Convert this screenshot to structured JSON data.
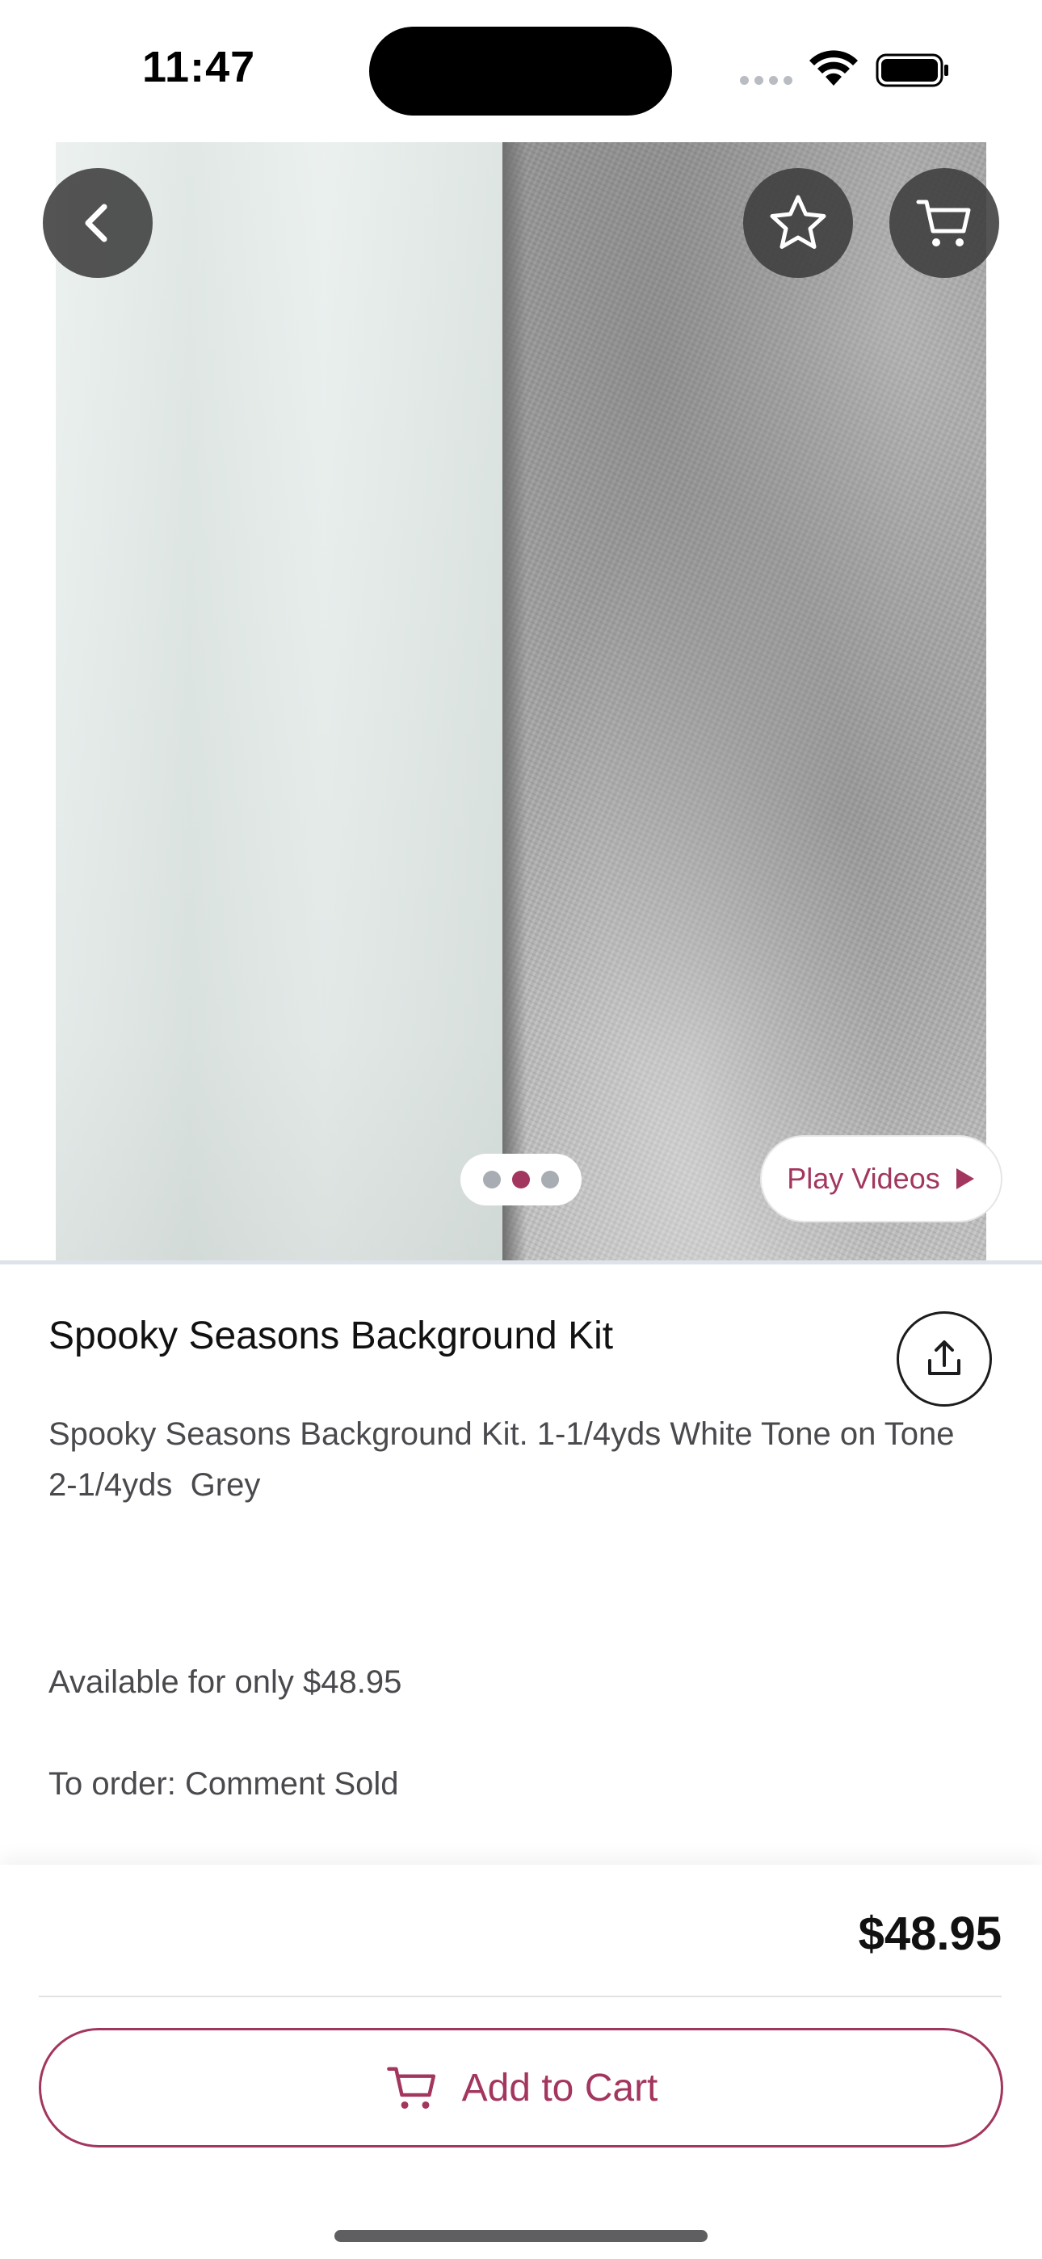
{
  "status_bar": {
    "time": "11:47",
    "icons": [
      "cellular-signal-icon",
      "wifi-icon",
      "battery-icon"
    ]
  },
  "hero": {
    "image_description_icons": [
      "fabric-white-tone",
      "fabric-grey"
    ],
    "buttons": [
      "back-icon",
      "star-icon",
      "cart-icon"
    ],
    "pager": {
      "count": 3,
      "active_index": 1
    },
    "play_videos_label": "Play Videos"
  },
  "product": {
    "title": "Spooky Seasons Background Kit",
    "description_line1": "Spooky Seasons Background Kit. 1-1/4yds White Tone on Tone",
    "description_line2": "2-1/4yds  Grey",
    "availability": "Available for only $48.95",
    "order_info": "To order: Comment Sold"
  },
  "purchase": {
    "price": "$48.95",
    "add_to_cart_label": "Add to Cart"
  },
  "colors": {
    "accent": "#a3365e",
    "pager_inactive": "#a8adb3",
    "hero_button_bg": "#3c3c3c"
  }
}
